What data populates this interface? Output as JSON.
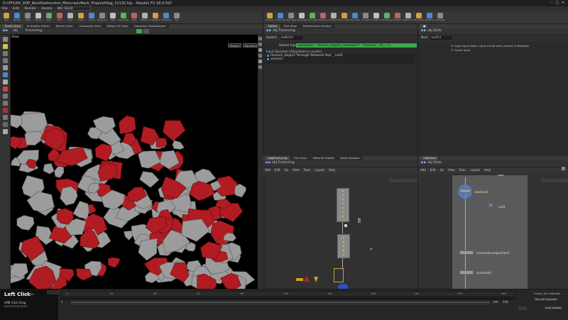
{
  "window": {
    "title": "D:/VFX/04_DOP_RockDestruction_Minicrash/Rock_Project/Oleg_11132.hip - Houdini FX 18.0.597",
    "controls": [
      "–",
      "□",
      "✕"
    ]
  },
  "menubar": [
    "File",
    "Edit",
    "Render",
    "Assets",
    "Windows",
    "Help"
  ],
  "desktop_selector": "Build",
  "shelf_left": [
    "Box",
    "Sphere",
    "Tube",
    "Torus",
    "Grid",
    "Null",
    "Line",
    "Circle",
    "Curve",
    "Draw Curve",
    "Path",
    "Spray Paint",
    "Font",
    "Platonic",
    "L-System",
    "Metaball",
    "File"
  ],
  "shelf_right": [
    "Camera",
    "Point Light",
    "Spot Light",
    "Area Light",
    "Geo Light",
    "Volume Light",
    "Distant Light",
    "Env Light",
    "Sky Light",
    "GI Light",
    "Caustic Light",
    "Portal Light",
    "Ambient Light",
    "Stereo Cam",
    "VR Camera",
    "Switcher",
    "Gamepad"
  ],
  "left_tabs": [
    "Scene View",
    "Animation Editor",
    "Render View",
    "Composite View",
    "Motion FX View",
    "Geometry Spreadsheet"
  ],
  "viewport": {
    "path_obj": "obj",
    "path_node": "Fracturing",
    "view_label": "View",
    "persp_btn": "Persp",
    "cam_btn": "No cam"
  },
  "param": {
    "tabs": [
      "Switch",
      "Tree View",
      "Performance Monitor"
    ],
    "path_obj": "obj",
    "path_node": "Fracturing",
    "node_type": "Switch",
    "node_name": "switch1",
    "select_label": "Select Input",
    "select_expr": "lvar(detail(\"../foreach_begin1_metadata1\", \"iteration\", 0)) < 3",
    "inputs_header": "Input Operators (Drag Node to reorder)",
    "inputs": [
      "foreach_begin1 through Network Box _ null1",
      "voronoi"
    ]
  },
  "spare": {
    "path_obj": "obj",
    "path_node": "Stats",
    "node_type": "Null",
    "node_name": "null11",
    "opt1": "Copy Input (Note: Input will be with content if disabled)",
    "opt2": "Cache Input"
  },
  "net_left": {
    "tabs": [
      "/obj/Fracturing",
      "Tree View",
      "Material Palette",
      "Asset Browser"
    ],
    "path_obj": "obj",
    "path_node": "Fracturing",
    "menu": [
      "Add",
      "Edit",
      "Go",
      "View",
      "Tools",
      "Layout",
      "Help"
    ],
    "context": "Geometry"
  },
  "net_right": {
    "tabs": [
      "/obj/Stats"
    ],
    "path_obj": "obj",
    "path_node": "Stats",
    "menu": [
      "Add",
      "Edit",
      "Go",
      "View",
      "Tools",
      "Layout",
      "Help"
    ],
    "context": "Geometry",
    "nodes": [
      "boolean2",
      "null1",
      "convexdecomposition2",
      "assemble1"
    ],
    "top_label": "stats"
  },
  "timeline": {
    "left_click": "Left Click",
    "key_hint": "Middle",
    "desc1": "LMB Click Drag",
    "desc2": "DESKTOP/MODULE",
    "frame_start": "1",
    "frame_end": "240",
    "frame_end2": "240",
    "ticks": [
      "0",
      "24",
      "48",
      "72",
      "96",
      "120",
      "144",
      "168",
      "192",
      "216",
      "240"
    ],
    "keys_label": "0 keys, 0/0 channels",
    "key_all": "Key All Channels",
    "auto_update": "Auto Update"
  },
  "colors": {
    "accent_green": "#3aa84a",
    "rock_red": "#b01c22",
    "rock_gray": "#9c9c9c"
  }
}
